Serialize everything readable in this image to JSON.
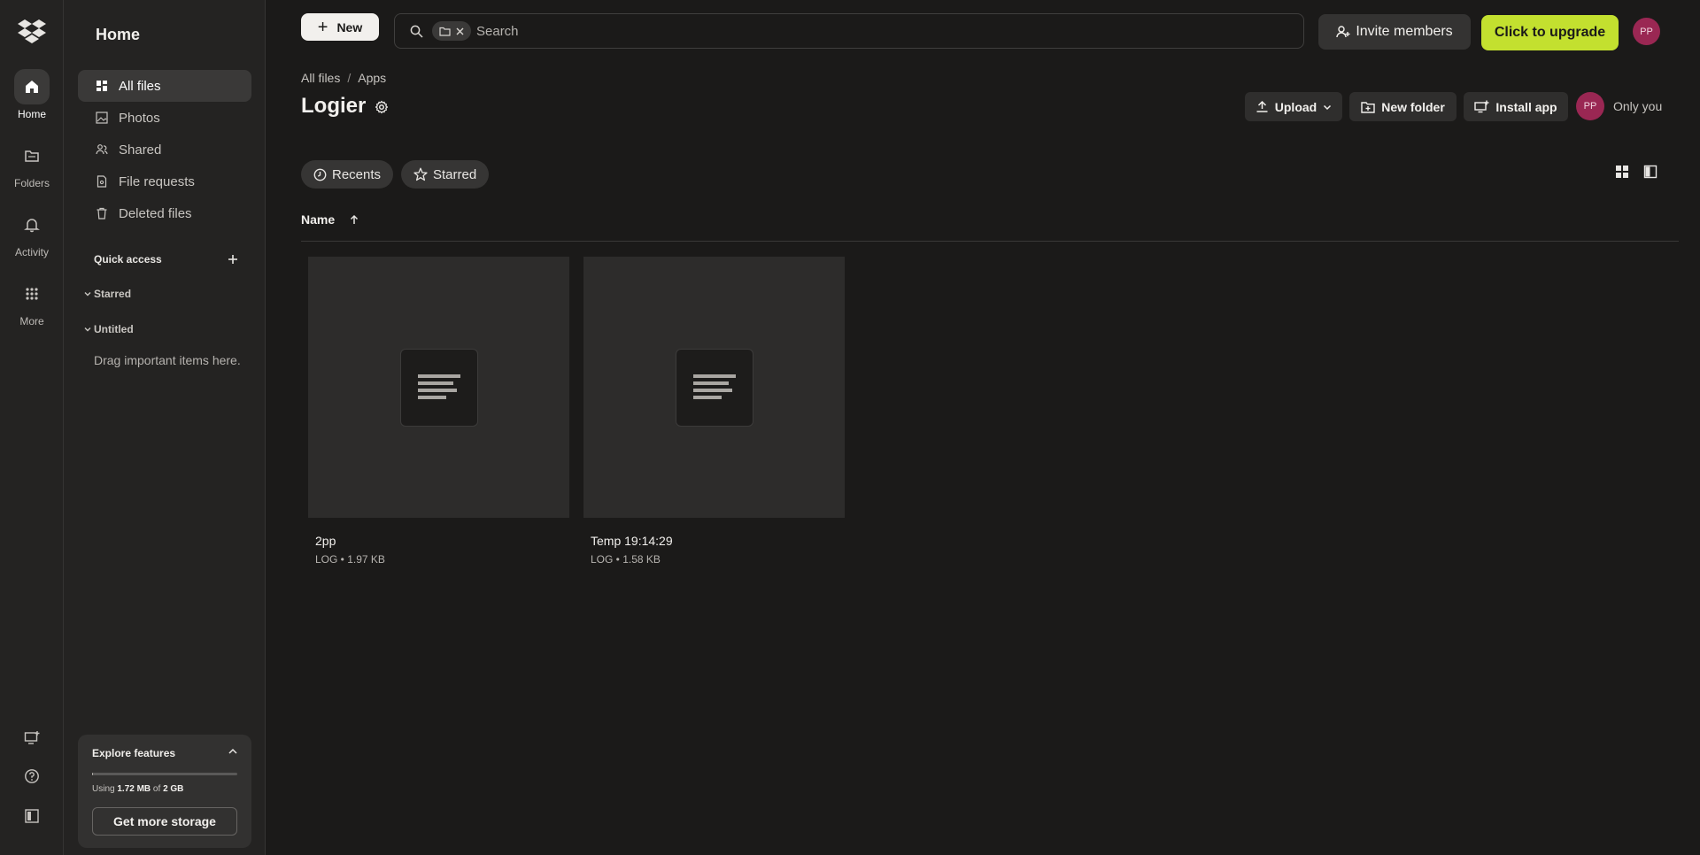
{
  "rail": {
    "items": [
      {
        "label": "Home",
        "icon": "home-icon"
      },
      {
        "label": "Folders",
        "icon": "folders-icon"
      },
      {
        "label": "Activity",
        "icon": "bell-icon"
      },
      {
        "label": "More",
        "icon": "grid-icon"
      }
    ]
  },
  "sidebar": {
    "title": "Home",
    "nav": [
      {
        "label": "All files",
        "icon": "all-files-icon"
      },
      {
        "label": "Photos",
        "icon": "photo-icon"
      },
      {
        "label": "Shared",
        "icon": "shared-icon"
      },
      {
        "label": "File requests",
        "icon": "file-request-icon"
      },
      {
        "label": "Deleted files",
        "icon": "trash-icon"
      }
    ],
    "quick_access": {
      "title": "Quick access",
      "groups": [
        "Starred",
        "Untitled"
      ],
      "hint": "Drag important items here."
    },
    "explore": {
      "title": "Explore features",
      "storage_prefix": "Using ",
      "storage_used": "1.72 MB",
      "storage_mid": " of ",
      "storage_total": "2 GB",
      "storage_fraction": 0.001,
      "button": "Get more storage"
    }
  },
  "topbar": {
    "new_label": "New",
    "search_placeholder": "Search",
    "invite_label": "Invite members",
    "upgrade_label": "Click to upgrade",
    "avatar_initials": "PP"
  },
  "header": {
    "breadcrumb": [
      "All files",
      "Apps"
    ],
    "breadcrumb_sep": "/",
    "title": "Logier",
    "upload_label": "Upload",
    "new_folder_label": "New folder",
    "install_label": "Install app",
    "share_initials": "PP",
    "share_label": "Only you"
  },
  "filters": {
    "recents": "Recents",
    "starred": "Starred"
  },
  "list": {
    "column_name": "Name",
    "files": [
      {
        "name": "2pp",
        "meta": "LOG • 1.97 KB"
      },
      {
        "name": "Temp 19:14:29",
        "meta": "LOG • 1.58 KB"
      }
    ]
  },
  "colors": {
    "accent": "#c3e02f",
    "avatar": "#9a2753",
    "background": "#1b1a19",
    "sidebar": "#242322"
  }
}
